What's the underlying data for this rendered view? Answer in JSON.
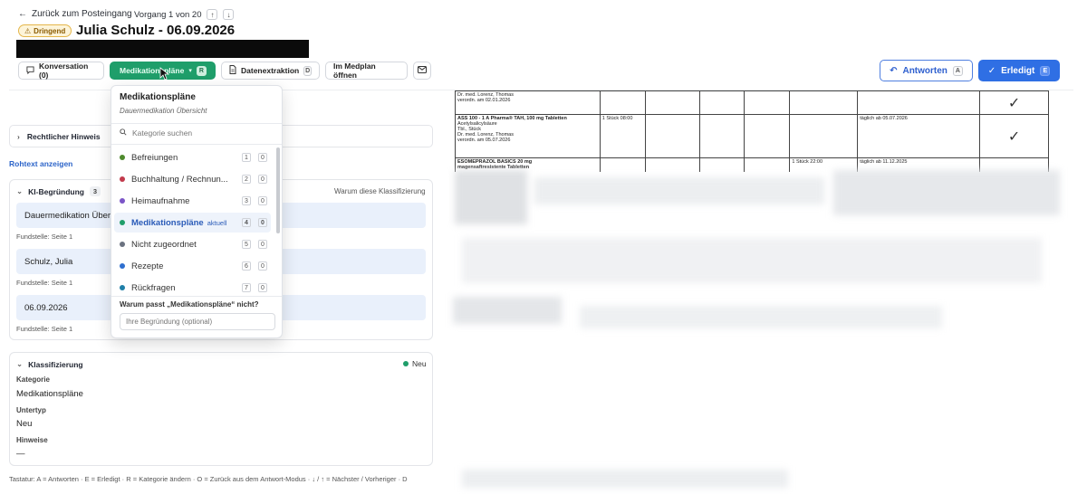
{
  "header": {
    "back_label": "Zurück zum Posteingang",
    "counter": "Vorgang 1 von 20",
    "up_icon": "↑",
    "down_icon": "↓",
    "urgent_badge": "Dringend",
    "title": "Julia Schulz - 06.09.2026"
  },
  "tabs": [
    {
      "label": "Konversation (0)",
      "icon": "chat-icon"
    },
    {
      "label": "Medikationspläne",
      "key": "R",
      "active": true
    },
    {
      "label": "Datenextraktion",
      "key": "D",
      "icon": "document-icon"
    },
    {
      "label": "Im Medplan öffnen"
    },
    {
      "icon": "mail-icon"
    }
  ],
  "actions": {
    "reply_label": "Antworten",
    "reply_key": "A",
    "done_label": "Erledigt",
    "done_key": "E"
  },
  "legal": {
    "label": "Rechtlicher Hinweis"
  },
  "raw_link": "Rohtext anzeigen",
  "ki": {
    "title": "KI-Begründung",
    "count": "3",
    "why": "Warum diese Klassifizierung",
    "evidence": [
      {
        "text": "Dauermedikation Übersicht",
        "source": "Fundstelle: Seite 1"
      },
      {
        "text": "Schulz, Julia",
        "source": "Fundstelle: Seite 1"
      },
      {
        "text": "06.09.2026",
        "source": "Fundstelle: Seite 1"
      }
    ]
  },
  "klass": {
    "title": "Klassifizierung",
    "status": "Neu",
    "status_color": "#1f9e6a",
    "category_label": "Kategorie",
    "category_value": "Medikationspläne",
    "subtype_label": "Untertyp",
    "subtype_value": "Neu",
    "notes_label": "Hinweise",
    "notes_value": "—"
  },
  "shortcuts": "Tastatur: A = Antworten · E = Erledigt · R = Kategorie ändern · O = Zurück aus dem Antwort-Modus · ↓ / ↑ = Nächster / Vorheriger · D",
  "dropdown": {
    "title": "Medikationspläne",
    "subtitle": "Dauermedikation Übersicht",
    "search_placeholder": "Kategorie suchen",
    "current_label": "aktuell",
    "items": [
      {
        "name": "Befreiungen",
        "key": "1",
        "count": "0",
        "color": "#4e8a2d"
      },
      {
        "name": "Buchhaltung / Rechnun...",
        "key": "2",
        "count": "0",
        "color": "#c23a4c"
      },
      {
        "name": "Heimaufnahme",
        "key": "3",
        "count": "0",
        "color": "#7b55c7"
      },
      {
        "name": "Medikationspläne",
        "key": "4",
        "count": "0",
        "color": "#1f9e6a",
        "active": true
      },
      {
        "name": "Nicht zugeordnet",
        "key": "5",
        "count": "0",
        "color": "#6b7280"
      },
      {
        "name": "Rezepte",
        "key": "6",
        "count": "0",
        "color": "#2f6fcf"
      },
      {
        "name": "Rückfragen",
        "key": "7",
        "count": "0",
        "color": "#1f7fa8"
      }
    ],
    "why_label": "Warum passt „Medikationspläne“ nicht?",
    "reason_placeholder": "Ihre Begründung (optional)"
  },
  "document": {
    "row1": {
      "c1": "Dr. med. Lorenz, Thomas\nverordn. am 02.01.2026"
    },
    "row2": {
      "c1": "ASS 100 - 1 A Pharma® TAH, 100 mg Tabletten",
      "c1b": "Acetylsalicylsäure\nTbl., Stück\nDr. med. Lorenz, Thomas\nverordn. am 05.07.2026",
      "c2": "1 Stück 08:00",
      "c3": "täglich ab 05.07.2026"
    },
    "row3": {
      "c1": "ESOMEPRAZOL BASICS 20 mg\nmagensaftresistente Tabletten",
      "c2": "1 Stück 22:00",
      "c3": "täglich ab 11.12.2025"
    },
    "check": "✓"
  }
}
